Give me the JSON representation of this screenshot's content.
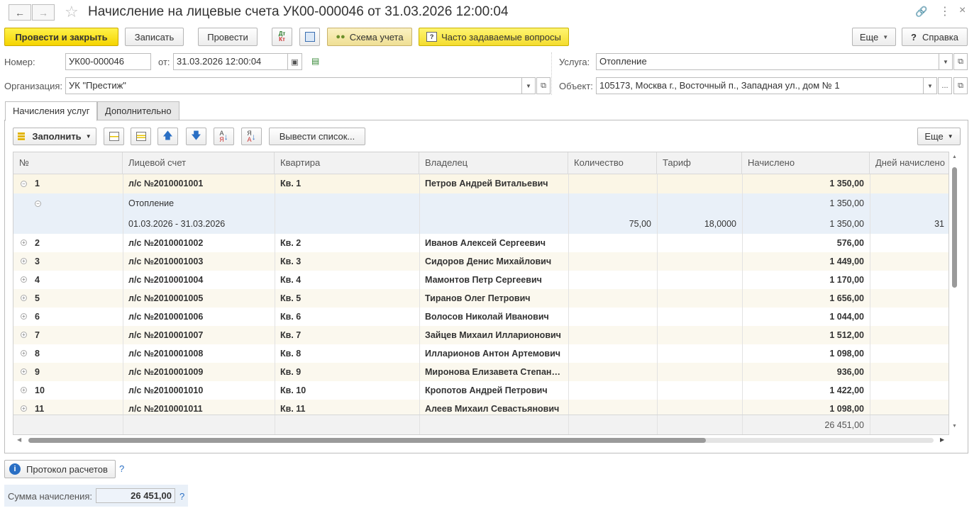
{
  "window": {
    "title": "Начисление на лицевые счета УК00-000046 от 31.03.2026 12:00:04",
    "back_icon": "arrow-left-icon",
    "forward_icon": "arrow-right-icon"
  },
  "toolbar": {
    "post_close": "Провести и закрыть",
    "save": "Записать",
    "post": "Провести",
    "dt_kt": "Дт Кт",
    "scheme": "Схема учета",
    "faq": "Часто задаваемые вопросы",
    "more": "Еще",
    "help": "Справка",
    "help_mark": "?"
  },
  "form": {
    "number_label": "Номер:",
    "number_value": "УК00-000046",
    "date_label": "от:",
    "date_value": "31.03.2026 12:00:04",
    "org_label": "Организация:",
    "org_value": "УК \"Престиж\"",
    "service_label": "Услуга:",
    "service_value": "Отопление",
    "object_label": "Объект:",
    "object_value": "105173, Москва г., Восточный п., Западная ул., дом № 1",
    "ellipsis": "..."
  },
  "tabs": [
    {
      "label": "Начисления услуг"
    },
    {
      "label": "Дополнительно"
    }
  ],
  "table_toolbar": {
    "fill": "Заполнить",
    "show_list": "Вывести список...",
    "more": "Еще"
  },
  "columns": [
    "№",
    "Лицевой счет",
    "Квартира",
    "Владелец",
    "Количество",
    "Тариф",
    "Начислено",
    "Дней начислено"
  ],
  "rows": [
    {
      "n": "1",
      "account": "л/с №2010001001",
      "flat": "Кв. 1",
      "owner": "Петров Андрей Витальевич",
      "amount": "1 350,00",
      "expanded": true
    },
    {
      "service": "Отопление",
      "amount": "1 350,00"
    },
    {
      "period": "01.03.2026 - 31.03.2026",
      "qty": "75,00",
      "tariff": "18,0000",
      "amount": "1 350,00",
      "days": "31"
    },
    {
      "n": "2",
      "account": "л/с №2010001002",
      "flat": "Кв. 2",
      "owner": "Иванов Алексей Сергеевич",
      "amount": "576,00"
    },
    {
      "n": "3",
      "account": "л/с №2010001003",
      "flat": "Кв. 3",
      "owner": "Сидоров Денис Михайлович",
      "amount": "1 449,00"
    },
    {
      "n": "4",
      "account": "л/с №2010001004",
      "flat": "Кв. 4",
      "owner": "Мамонтов Петр Сергеевич",
      "amount": "1 170,00"
    },
    {
      "n": "5",
      "account": "л/с №2010001005",
      "flat": "Кв. 5",
      "owner": "Тиранов Олег Петрович",
      "amount": "1 656,00"
    },
    {
      "n": "6",
      "account": "л/с №2010001006",
      "flat": "Кв. 6",
      "owner": "Волосов Николай Иванович",
      "amount": "1 044,00"
    },
    {
      "n": "7",
      "account": "л/с №2010001007",
      "flat": "Кв. 7",
      "owner": "Зайцев Михаил Илларионович",
      "amount": "1 512,00"
    },
    {
      "n": "8",
      "account": "л/с №2010001008",
      "flat": "Кв. 8",
      "owner": "Илларионов Антон Артемович",
      "amount": "1 098,00"
    },
    {
      "n": "9",
      "account": "л/с №2010001009",
      "flat": "Кв. 9",
      "owner": "Миронова Елизавета Степанов...",
      "amount": "936,00"
    },
    {
      "n": "10",
      "account": "л/с №2010001010",
      "flat": "Кв. 10",
      "owner": "Кропотов Андрей Петрович",
      "amount": "1 422,00"
    },
    {
      "n": "11",
      "account": "л/с №2010001011",
      "flat": "Кв. 11",
      "owner": "Алеев Михаил Севастьянович",
      "amount": "1 098,00"
    }
  ],
  "footer_total": "26 451,00",
  "bottom": {
    "protocol": "Протокол расчетов",
    "help_mark": "?",
    "sum_label": "Сумма начисления:",
    "sum_value": "26 451,00"
  }
}
